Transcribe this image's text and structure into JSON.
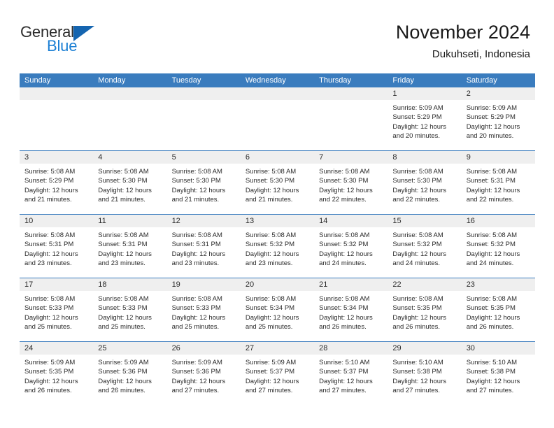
{
  "brand": {
    "name_part1": "General",
    "name_part2": "Blue",
    "accent_color": "#1b7fd4",
    "flag_color": "#1565b0"
  },
  "header": {
    "title": "November 2024",
    "subtitle": "Dukuhseti, Indonesia"
  },
  "theme": {
    "header_blue": "#3a7cbe",
    "day_band_gray": "#efefef",
    "text_color": "#2b2b2b"
  },
  "weekday_headers": [
    "Sunday",
    "Monday",
    "Tuesday",
    "Wednesday",
    "Thursday",
    "Friday",
    "Saturday"
  ],
  "weeks": [
    [
      {
        "day": "",
        "empty": true
      },
      {
        "day": "",
        "empty": true
      },
      {
        "day": "",
        "empty": true
      },
      {
        "day": "",
        "empty": true
      },
      {
        "day": "",
        "empty": true
      },
      {
        "day": "1",
        "sunrise": "Sunrise: 5:09 AM",
        "sunset": "Sunset: 5:29 PM",
        "daylight_line1": "Daylight: 12 hours",
        "daylight_line2": "and 20 minutes."
      },
      {
        "day": "2",
        "sunrise": "Sunrise: 5:09 AM",
        "sunset": "Sunset: 5:29 PM",
        "daylight_line1": "Daylight: 12 hours",
        "daylight_line2": "and 20 minutes."
      }
    ],
    [
      {
        "day": "3",
        "sunrise": "Sunrise: 5:08 AM",
        "sunset": "Sunset: 5:29 PM",
        "daylight_line1": "Daylight: 12 hours",
        "daylight_line2": "and 21 minutes."
      },
      {
        "day": "4",
        "sunrise": "Sunrise: 5:08 AM",
        "sunset": "Sunset: 5:30 PM",
        "daylight_line1": "Daylight: 12 hours",
        "daylight_line2": "and 21 minutes."
      },
      {
        "day": "5",
        "sunrise": "Sunrise: 5:08 AM",
        "sunset": "Sunset: 5:30 PM",
        "daylight_line1": "Daylight: 12 hours",
        "daylight_line2": "and 21 minutes."
      },
      {
        "day": "6",
        "sunrise": "Sunrise: 5:08 AM",
        "sunset": "Sunset: 5:30 PM",
        "daylight_line1": "Daylight: 12 hours",
        "daylight_line2": "and 21 minutes."
      },
      {
        "day": "7",
        "sunrise": "Sunrise: 5:08 AM",
        "sunset": "Sunset: 5:30 PM",
        "daylight_line1": "Daylight: 12 hours",
        "daylight_line2": "and 22 minutes."
      },
      {
        "day": "8",
        "sunrise": "Sunrise: 5:08 AM",
        "sunset": "Sunset: 5:30 PM",
        "daylight_line1": "Daylight: 12 hours",
        "daylight_line2": "and 22 minutes."
      },
      {
        "day": "9",
        "sunrise": "Sunrise: 5:08 AM",
        "sunset": "Sunset: 5:31 PM",
        "daylight_line1": "Daylight: 12 hours",
        "daylight_line2": "and 22 minutes."
      }
    ],
    [
      {
        "day": "10",
        "sunrise": "Sunrise: 5:08 AM",
        "sunset": "Sunset: 5:31 PM",
        "daylight_line1": "Daylight: 12 hours",
        "daylight_line2": "and 23 minutes."
      },
      {
        "day": "11",
        "sunrise": "Sunrise: 5:08 AM",
        "sunset": "Sunset: 5:31 PM",
        "daylight_line1": "Daylight: 12 hours",
        "daylight_line2": "and 23 minutes."
      },
      {
        "day": "12",
        "sunrise": "Sunrise: 5:08 AM",
        "sunset": "Sunset: 5:31 PM",
        "daylight_line1": "Daylight: 12 hours",
        "daylight_line2": "and 23 minutes."
      },
      {
        "day": "13",
        "sunrise": "Sunrise: 5:08 AM",
        "sunset": "Sunset: 5:32 PM",
        "daylight_line1": "Daylight: 12 hours",
        "daylight_line2": "and 23 minutes."
      },
      {
        "day": "14",
        "sunrise": "Sunrise: 5:08 AM",
        "sunset": "Sunset: 5:32 PM",
        "daylight_line1": "Daylight: 12 hours",
        "daylight_line2": "and 24 minutes."
      },
      {
        "day": "15",
        "sunrise": "Sunrise: 5:08 AM",
        "sunset": "Sunset: 5:32 PM",
        "daylight_line1": "Daylight: 12 hours",
        "daylight_line2": "and 24 minutes."
      },
      {
        "day": "16",
        "sunrise": "Sunrise: 5:08 AM",
        "sunset": "Sunset: 5:32 PM",
        "daylight_line1": "Daylight: 12 hours",
        "daylight_line2": "and 24 minutes."
      }
    ],
    [
      {
        "day": "17",
        "sunrise": "Sunrise: 5:08 AM",
        "sunset": "Sunset: 5:33 PM",
        "daylight_line1": "Daylight: 12 hours",
        "daylight_line2": "and 25 minutes."
      },
      {
        "day": "18",
        "sunrise": "Sunrise: 5:08 AM",
        "sunset": "Sunset: 5:33 PM",
        "daylight_line1": "Daylight: 12 hours",
        "daylight_line2": "and 25 minutes."
      },
      {
        "day": "19",
        "sunrise": "Sunrise: 5:08 AM",
        "sunset": "Sunset: 5:33 PM",
        "daylight_line1": "Daylight: 12 hours",
        "daylight_line2": "and 25 minutes."
      },
      {
        "day": "20",
        "sunrise": "Sunrise: 5:08 AM",
        "sunset": "Sunset: 5:34 PM",
        "daylight_line1": "Daylight: 12 hours",
        "daylight_line2": "and 25 minutes."
      },
      {
        "day": "21",
        "sunrise": "Sunrise: 5:08 AM",
        "sunset": "Sunset: 5:34 PM",
        "daylight_line1": "Daylight: 12 hours",
        "daylight_line2": "and 26 minutes."
      },
      {
        "day": "22",
        "sunrise": "Sunrise: 5:08 AM",
        "sunset": "Sunset: 5:35 PM",
        "daylight_line1": "Daylight: 12 hours",
        "daylight_line2": "and 26 minutes."
      },
      {
        "day": "23",
        "sunrise": "Sunrise: 5:08 AM",
        "sunset": "Sunset: 5:35 PM",
        "daylight_line1": "Daylight: 12 hours",
        "daylight_line2": "and 26 minutes."
      }
    ],
    [
      {
        "day": "24",
        "sunrise": "Sunrise: 5:09 AM",
        "sunset": "Sunset: 5:35 PM",
        "daylight_line1": "Daylight: 12 hours",
        "daylight_line2": "and 26 minutes."
      },
      {
        "day": "25",
        "sunrise": "Sunrise: 5:09 AM",
        "sunset": "Sunset: 5:36 PM",
        "daylight_line1": "Daylight: 12 hours",
        "daylight_line2": "and 26 minutes."
      },
      {
        "day": "26",
        "sunrise": "Sunrise: 5:09 AM",
        "sunset": "Sunset: 5:36 PM",
        "daylight_line1": "Daylight: 12 hours",
        "daylight_line2": "and 27 minutes."
      },
      {
        "day": "27",
        "sunrise": "Sunrise: 5:09 AM",
        "sunset": "Sunset: 5:37 PM",
        "daylight_line1": "Daylight: 12 hours",
        "daylight_line2": "and 27 minutes."
      },
      {
        "day": "28",
        "sunrise": "Sunrise: 5:10 AM",
        "sunset": "Sunset: 5:37 PM",
        "daylight_line1": "Daylight: 12 hours",
        "daylight_line2": "and 27 minutes."
      },
      {
        "day": "29",
        "sunrise": "Sunrise: 5:10 AM",
        "sunset": "Sunset: 5:38 PM",
        "daylight_line1": "Daylight: 12 hours",
        "daylight_line2": "and 27 minutes."
      },
      {
        "day": "30",
        "sunrise": "Sunrise: 5:10 AM",
        "sunset": "Sunset: 5:38 PM",
        "daylight_line1": "Daylight: 12 hours",
        "daylight_line2": "and 27 minutes."
      }
    ]
  ]
}
